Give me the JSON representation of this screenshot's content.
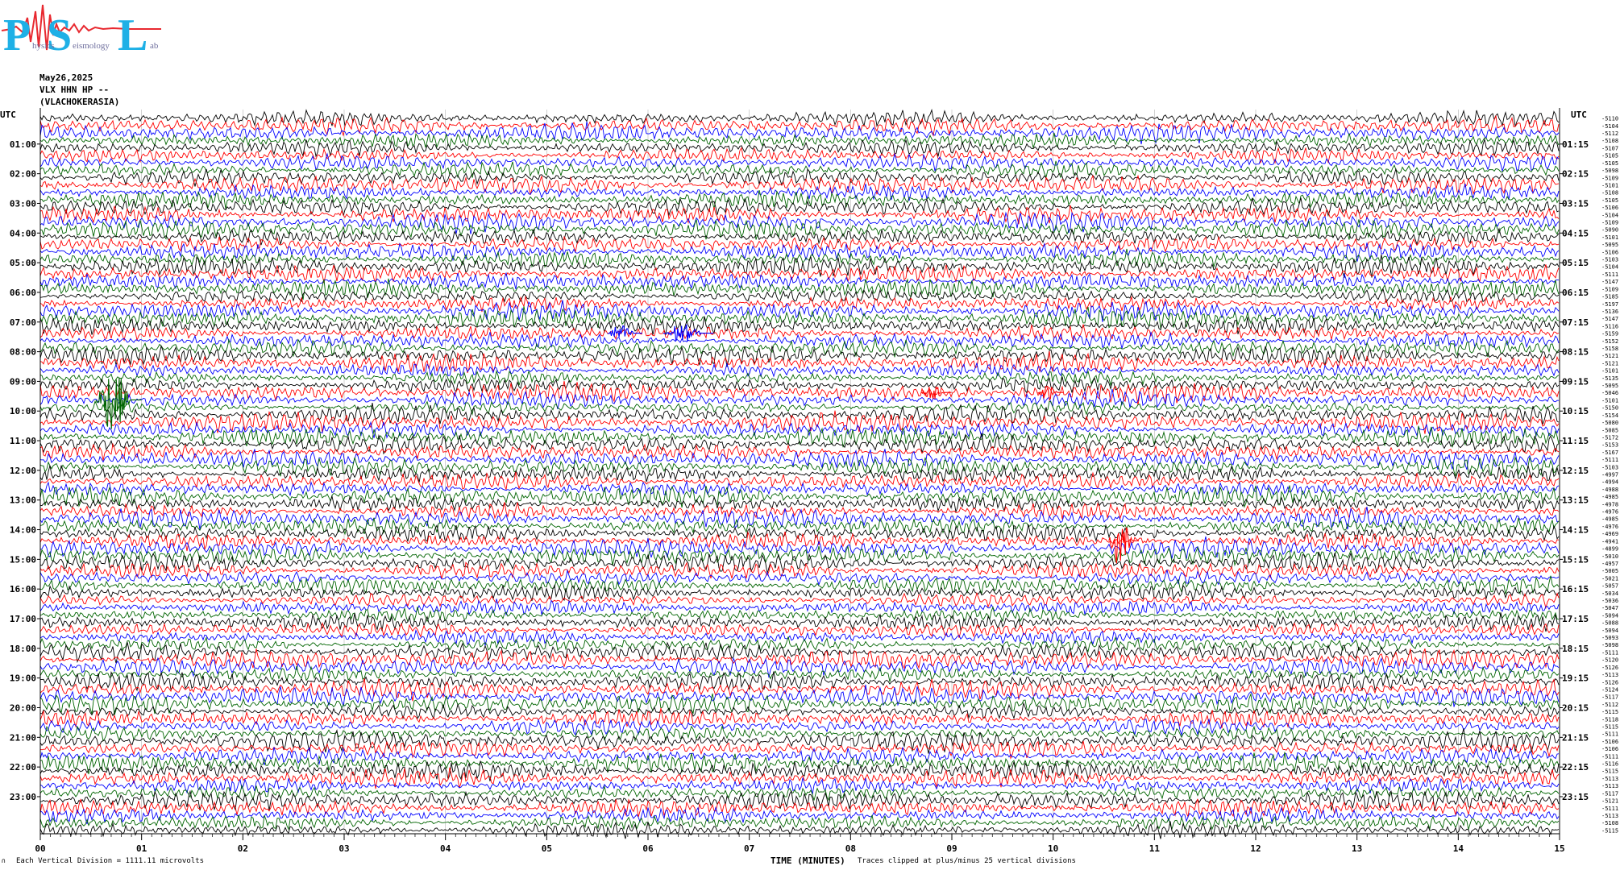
{
  "logo": {
    "big_letters": [
      "P",
      "S",
      "L"
    ],
    "small_texts": [
      "hysics",
      "eismology",
      "ab"
    ],
    "colors": {
      "letters": "#1eb0e6",
      "trace": "#e8282f",
      "small_text": "#6f6f9e"
    }
  },
  "header": {
    "date": "May26,2025",
    "channel": "VLX HHN HP --",
    "station": "(VLACHOKERASIA)"
  },
  "footer": {
    "corner_mark": "∩",
    "scale_note": "Each Vertical Division = 1111.11 microvolts",
    "axis_title": "TIME (MINUTES)",
    "clip_note": "Traces clipped at plus/minus 25 vertical divisions"
  },
  "chart_data": {
    "type": "helicorder",
    "left_axis_title": "UTC",
    "right_axis_title": "UTC",
    "left_time_labels": [
      "01:00",
      "02:00",
      "03:00",
      "04:00",
      "05:00",
      "06:00",
      "07:00",
      "08:00",
      "09:00",
      "10:00",
      "11:00",
      "12:00",
      "13:00",
      "14:00",
      "15:00",
      "16:00",
      "17:00",
      "18:00",
      "19:00",
      "20:00",
      "21:00",
      "22:00",
      "23:00"
    ],
    "right_time_labels": [
      "01:15",
      "02:15",
      "03:15",
      "04:15",
      "05:15",
      "06:15",
      "07:15",
      "08:15",
      "09:15",
      "10:15",
      "11:15",
      "12:15",
      "13:15",
      "14:15",
      "15:15",
      "16:15",
      "17:15",
      "18:15",
      "19:15",
      "20:15",
      "21:15",
      "22:15",
      "23:15"
    ],
    "x_tick_labels": [
      "00",
      "01",
      "02",
      "03",
      "04",
      "05",
      "06",
      "07",
      "08",
      "09",
      "10",
      "11",
      "12",
      "13",
      "14",
      "15"
    ],
    "xlim": [
      0,
      15
    ],
    "trace_minutes_per_line": 15,
    "lines_per_hour": 4,
    "trace_colors": [
      "#000000",
      "#ff0000",
      "#0000ff",
      "#006400"
    ],
    "trace_offsets": [
      "-5110",
      "-5104",
      "-5112",
      "-5108",
      "-5107",
      "-5105",
      "-5105",
      "-5098",
      "-5109",
      "-5101",
      "-5108",
      "-5105",
      "-5106",
      "-5104",
      "-5109",
      "-5090",
      "-5101",
      "-5095",
      "-5106",
      "-5103",
      "-5104",
      "-5111",
      "-5147",
      "-5109",
      "-5185",
      "-5197",
      "-5136",
      "-5147",
      "-5116",
      "-5159",
      "-5152",
      "-5158",
      "-5121",
      "-5121",
      "-5101",
      "-5135",
      "-5095",
      "-5046",
      "-5101",
      "-5150",
      "-5154",
      "-5080",
      "-5085",
      "-5172",
      "-5153",
      "-5167",
      "-5111",
      "-5103",
      "-4997",
      "-4994",
      "-4988",
      "-4985",
      "-4978",
      "-4976",
      "-4985",
      "-4976",
      "-4969",
      "-4941",
      "-4899",
      "-5010",
      "-4957",
      "-5005",
      "-5021",
      "-5057",
      "-5034",
      "-5036",
      "-5047",
      "-5094",
      "-5088",
      "-5094",
      "-5093",
      "-5098",
      "-5111",
      "-5120",
      "-5126",
      "-5113",
      "-5126",
      "-5124",
      "-5117",
      "-5112",
      "-5115",
      "-5118",
      "-5115",
      "-5111",
      "-5106",
      "-5106",
      "-5111",
      "-5116",
      "-5115",
      "-5113",
      "-5113",
      "-5117",
      "-5121",
      "-5111",
      "-5113",
      "-5108",
      "-5115"
    ],
    "events": [
      {
        "minute": 0.55,
        "trace_index": 38,
        "color": "#006400",
        "amplitude": 2.2,
        "duration_minutes": 0.45
      },
      {
        "minute": 5.6,
        "trace_index": 29,
        "color": "#0000ff",
        "amplitude": 0.6,
        "duration_minutes": 0.35
      },
      {
        "minute": 6.15,
        "trace_index": 29,
        "color": "#0000ff",
        "amplitude": 0.7,
        "duration_minutes": 0.5
      },
      {
        "minute": 8.7,
        "trace_index": 37,
        "color": "#ff0000",
        "amplitude": 0.5,
        "duration_minutes": 0.3
      },
      {
        "minute": 9.85,
        "trace_index": 37,
        "color": "#ff0000",
        "amplitude": 0.6,
        "duration_minutes": 0.25
      },
      {
        "minute": 10.55,
        "trace_index": 57,
        "color": "#ff0000",
        "amplitude": 1.8,
        "duration_minutes": 0.3
      }
    ]
  }
}
